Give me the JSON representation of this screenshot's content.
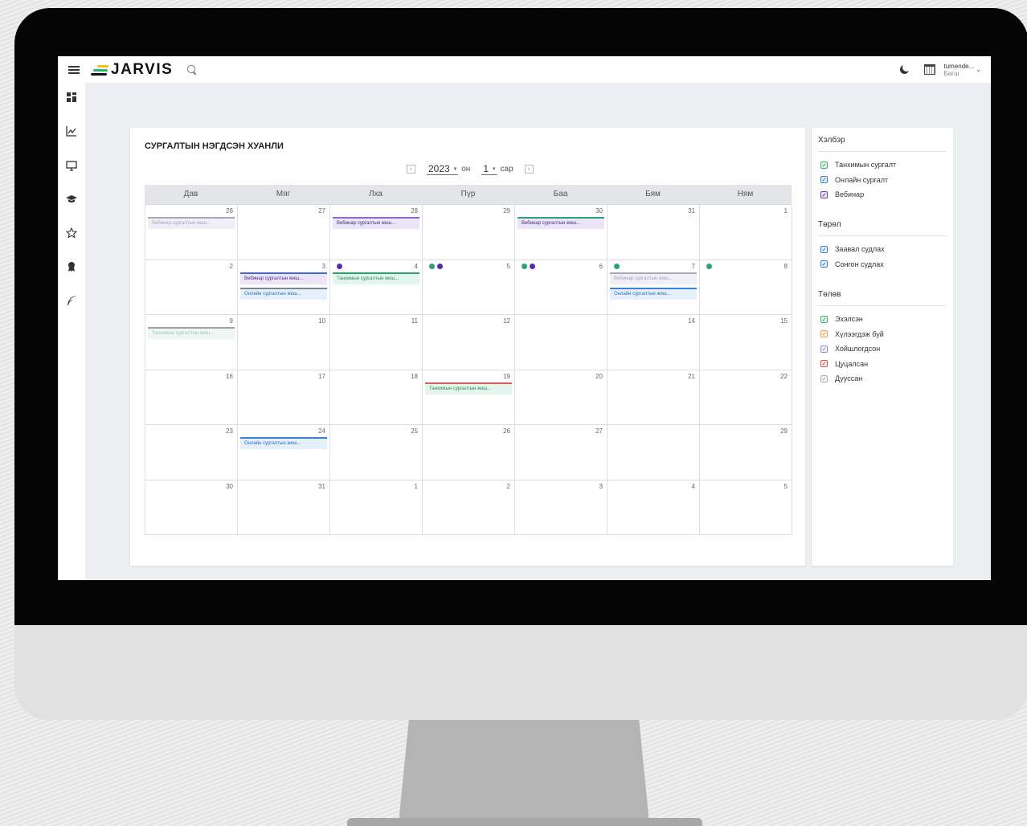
{
  "header": {
    "logo_text": "JARVIS",
    "user_name": "tumende...",
    "user_role": "Багш",
    "caret": "⌄"
  },
  "sidebar": {
    "icons": [
      "dashboard-icon",
      "chart-line-icon",
      "monitor-icon",
      "graduation-cap-icon",
      "star-icon",
      "award-icon",
      "feather-icon"
    ]
  },
  "calendar": {
    "title": "СУРГАЛТЫН НЭГДСЭН ХУАНЛИ",
    "prev": "‹",
    "next": "›",
    "year": "2023",
    "year_unit": "он",
    "month": "1",
    "month_unit": "сар",
    "caret": "▾",
    "weekdays": [
      "Дав",
      "Мяг",
      "Лха",
      "Пүр",
      "Баа",
      "Бям",
      "Ням"
    ],
    "days": [
      {
        "num": "26",
        "dots": [],
        "events": [
          {
            "label": "Вебинар сургалтын жиш...",
            "type": "webinar-past"
          }
        ]
      },
      {
        "num": "27",
        "dots": [],
        "events": []
      },
      {
        "num": "28",
        "dots": [],
        "events": [
          {
            "label": "Вебинар сургалтын жиш...",
            "type": "webinar"
          }
        ]
      },
      {
        "num": "29",
        "dots": [],
        "events": []
      },
      {
        "num": "30",
        "dots": [],
        "events": [
          {
            "label": "Вебинар сургалтын жиш...",
            "type": "webinar-green"
          }
        ]
      },
      {
        "num": "31",
        "dots": [],
        "events": []
      },
      {
        "num": "1",
        "dots": [],
        "events": []
      },
      {
        "num": "2",
        "dots": [],
        "events": []
      },
      {
        "num": "3",
        "dots": [],
        "events": [
          {
            "label": "Вебинар сургалтын жиш...",
            "type": "webinar-blue"
          },
          {
            "label": "Онлайн сургалтын жиш...",
            "type": "online-gray"
          }
        ]
      },
      {
        "num": "4",
        "dots": [
          "purple"
        ],
        "events": [
          {
            "label": "Танхимын сургалтын жиш...",
            "type": "classroom"
          }
        ]
      },
      {
        "num": "5",
        "dots": [
          "green",
          "purple"
        ],
        "events": []
      },
      {
        "num": "6",
        "dots": [
          "green",
          "purple"
        ],
        "events": []
      },
      {
        "num": "7",
        "dots": [
          "green"
        ],
        "events": [
          {
            "label": "Вебинар сургалтын жиш...",
            "type": "webinar-past"
          },
          {
            "label": "Онлайн сургалтын жиш...",
            "type": "online"
          }
        ]
      },
      {
        "num": "8",
        "dots": [
          "green"
        ],
        "events": []
      },
      {
        "num": "9",
        "dots": [],
        "events": [
          {
            "label": "Танхимын сургалтын жиш...",
            "type": "classroom-past"
          }
        ]
      },
      {
        "num": "10",
        "dots": [],
        "events": []
      },
      {
        "num": "11",
        "dots": [],
        "events": []
      },
      {
        "num": "12",
        "dots": [],
        "events": []
      },
      {
        "num": "",
        "dots": [],
        "events": []
      },
      {
        "num": "14",
        "dots": [],
        "events": []
      },
      {
        "num": "15",
        "dots": [],
        "events": []
      },
      {
        "num": "16",
        "dots": [],
        "events": []
      },
      {
        "num": "17",
        "dots": [],
        "events": []
      },
      {
        "num": "18",
        "dots": [],
        "events": []
      },
      {
        "num": "19",
        "dots": [],
        "events": [
          {
            "label": "Танхимын сургалтын жиш...",
            "type": "classroom-red"
          }
        ]
      },
      {
        "num": "20",
        "dots": [],
        "events": []
      },
      {
        "num": "21",
        "dots": [],
        "events": []
      },
      {
        "num": "22",
        "dots": [],
        "events": []
      },
      {
        "num": "23",
        "dots": [],
        "events": []
      },
      {
        "num": "24",
        "dots": [],
        "events": [
          {
            "label": "Онлайн сургалтын жиш...",
            "type": "online"
          }
        ]
      },
      {
        "num": "25",
        "dots": [],
        "events": []
      },
      {
        "num": "26",
        "dots": [],
        "events": []
      },
      {
        "num": "27",
        "dots": [],
        "events": []
      },
      {
        "num": "",
        "dots": [],
        "events": []
      },
      {
        "num": "29",
        "dots": [],
        "events": []
      },
      {
        "num": "30",
        "dots": [],
        "events": []
      },
      {
        "num": "31",
        "dots": [],
        "events": []
      },
      {
        "num": "1",
        "dots": [],
        "events": []
      },
      {
        "num": "2",
        "dots": [],
        "events": []
      },
      {
        "num": "3",
        "dots": [],
        "events": []
      },
      {
        "num": "4",
        "dots": [],
        "events": []
      },
      {
        "num": "5",
        "dots": [],
        "events": []
      }
    ]
  },
  "filters": {
    "sections": [
      {
        "title": "Хэлбэр",
        "items": [
          {
            "label": "Танхимын сургалт",
            "color": "#3cb371",
            "checked": true
          },
          {
            "label": "Онлайн сургалт",
            "color": "#3b82d6",
            "checked": true
          },
          {
            "label": "Вебинар",
            "color": "#6a3fb5",
            "checked": true
          }
        ]
      },
      {
        "title": "Төрөл",
        "items": [
          {
            "label": "Заавал судлах",
            "color": "#3b82d6",
            "checked": true
          },
          {
            "label": "Сонгон судлах",
            "color": "#3b82d6",
            "checked": true
          }
        ]
      },
      {
        "title": "Төлөв",
        "items": [
          {
            "label": "Эхэлсэн",
            "color": "#3cb371",
            "checked": true
          },
          {
            "label": "Хүлээгдэж буй",
            "color": "#f0a050",
            "checked": true
          },
          {
            "label": "Хойшлогдсон",
            "color": "#9a8cc8",
            "checked": true
          },
          {
            "label": "Цуцалсан",
            "color": "#e05555",
            "checked": true
          },
          {
            "label": "Дууссан",
            "color": "#aaaaaa",
            "checked": true
          }
        ]
      }
    ]
  },
  "colors": {
    "green": "#2aa27a",
    "purple": "#5b2aa8",
    "logo_yellow": "#f2c21b",
    "logo_green": "#2bb673"
  }
}
